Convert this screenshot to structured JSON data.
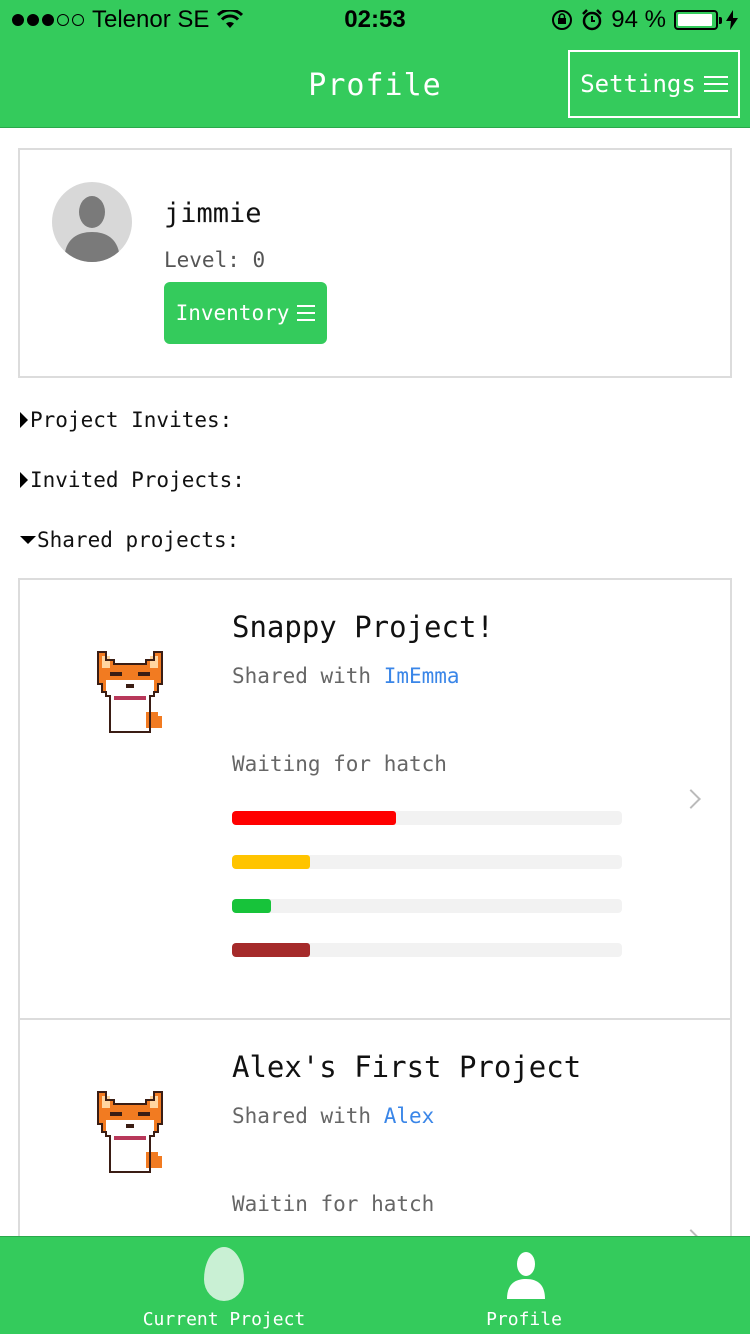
{
  "status_bar": {
    "carrier": "Telenor SE",
    "time": "02:53",
    "battery_percent": "94 %",
    "battery_level": 0.94,
    "signal_bars_filled": 3,
    "signal_bars_total": 5
  },
  "nav": {
    "title": "Profile",
    "settings_label": "Settings"
  },
  "profile": {
    "username": "jimmie",
    "level": "Level: 0",
    "inventory_label": "Inventory"
  },
  "sections": {
    "project_invites": "Project Invites:",
    "invited_projects": "Invited Projects:",
    "shared_projects": "Shared projects:"
  },
  "projects": [
    {
      "title": "Snappy Project!",
      "shared_prefix": "Shared with ",
      "shared_with": "ImEmma",
      "status": "Waiting for hatch",
      "bars": [
        {
          "value": 0.42,
          "color": "#ff0000"
        },
        {
          "value": 0.2,
          "color": "#ffc400"
        },
        {
          "value": 0.1,
          "color": "#17c33a"
        },
        {
          "value": 0.2,
          "color": "#a52a2a"
        }
      ]
    },
    {
      "title": "Alex's First Project",
      "shared_prefix": "Shared with ",
      "shared_with": "Alex",
      "status": "Waitin for hatch"
    }
  ],
  "tabs": {
    "current_project": "Current Project",
    "profile": "Profile"
  },
  "colors": {
    "brand_green": "#34cb5c",
    "link_blue": "#3a86e8"
  }
}
